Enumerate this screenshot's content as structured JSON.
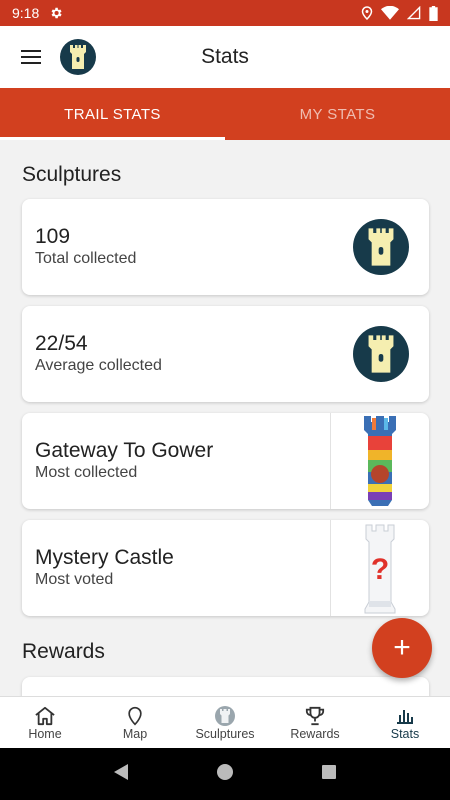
{
  "status_bar": {
    "time": "9:18"
  },
  "app_bar": {
    "title": "Stats"
  },
  "tabs": [
    {
      "label": "TRAIL STATS",
      "active": true
    },
    {
      "label": "MY STATS",
      "active": false
    }
  ],
  "sections": {
    "sculptures_title": "Sculptures",
    "rewards_title": "Rewards"
  },
  "cards": [
    {
      "value": "109",
      "label": "Total collected",
      "icon": "castle-tower-icon"
    },
    {
      "value": "22/54",
      "label": "Average collected",
      "icon": "castle-tower-icon"
    },
    {
      "value": "Gateway To Gower",
      "label": "Most collected",
      "icon": "sculpture-thumbnail"
    },
    {
      "value": "Mystery Castle",
      "label": "Most voted",
      "icon": "mystery-castle-thumbnail"
    }
  ],
  "fab": {
    "icon": "plus-icon",
    "glyph": "+"
  },
  "bottom_nav": [
    {
      "label": "Home",
      "icon": "home-icon"
    },
    {
      "label": "Map",
      "icon": "map-pin-icon"
    },
    {
      "label": "Sculptures",
      "icon": "castle-tower-icon"
    },
    {
      "label": "Rewards",
      "icon": "trophy-icon"
    },
    {
      "label": "Stats",
      "icon": "bar-chart-icon",
      "active": true
    }
  ],
  "colors": {
    "primary": "#d2401f",
    "status_bar": "#c8371f",
    "badge": "#173a4a",
    "tower": "#f5eeb0"
  }
}
